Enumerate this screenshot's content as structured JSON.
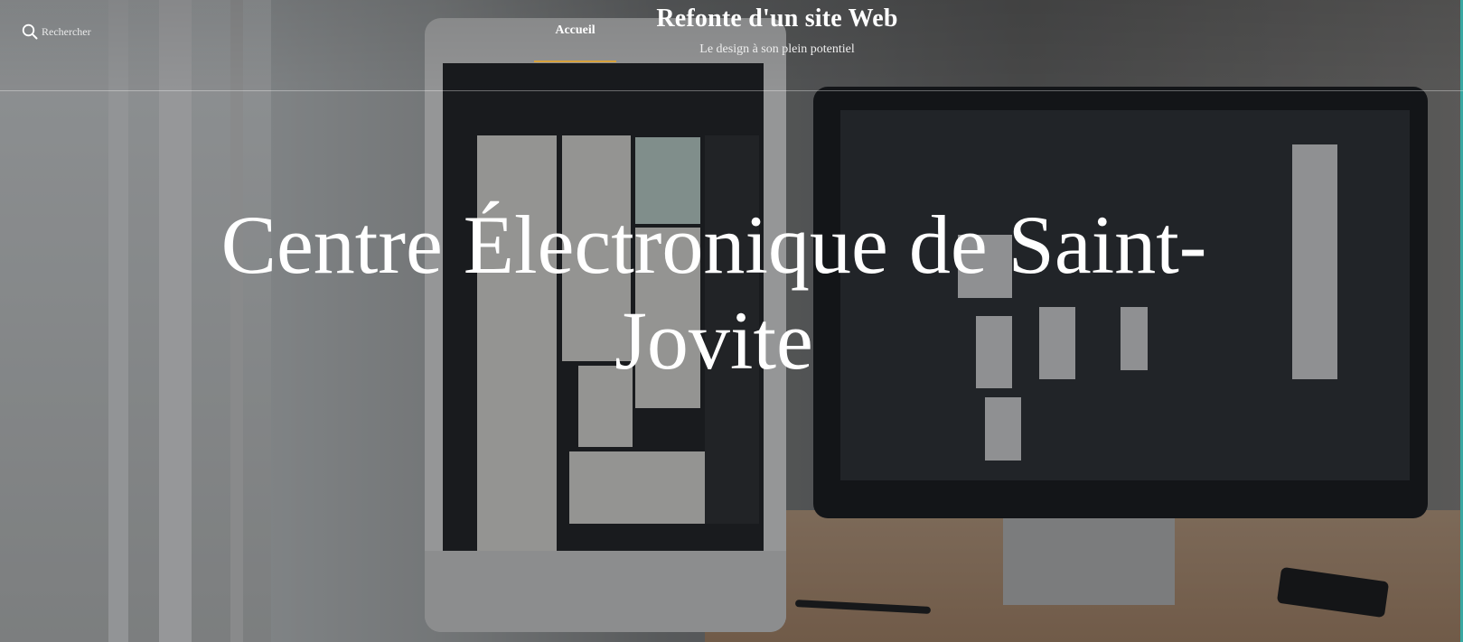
{
  "header": {
    "search_label": "Rechercher",
    "nav": [
      {
        "label": "Accueil",
        "active": true
      }
    ],
    "site_title": "Refonte d'un site Web",
    "tagline": "Le design à son plein potentiel"
  },
  "hero": {
    "heading": "Centre Électronique de Saint-Jovite"
  },
  "icons": {
    "search": "search-icon"
  },
  "colors": {
    "nav_active_underline": "#d6a13b",
    "text": "#ffffff",
    "overlay": "rgba(20, 22, 26, 0.42)",
    "edge_accent": "#38a7a1"
  }
}
